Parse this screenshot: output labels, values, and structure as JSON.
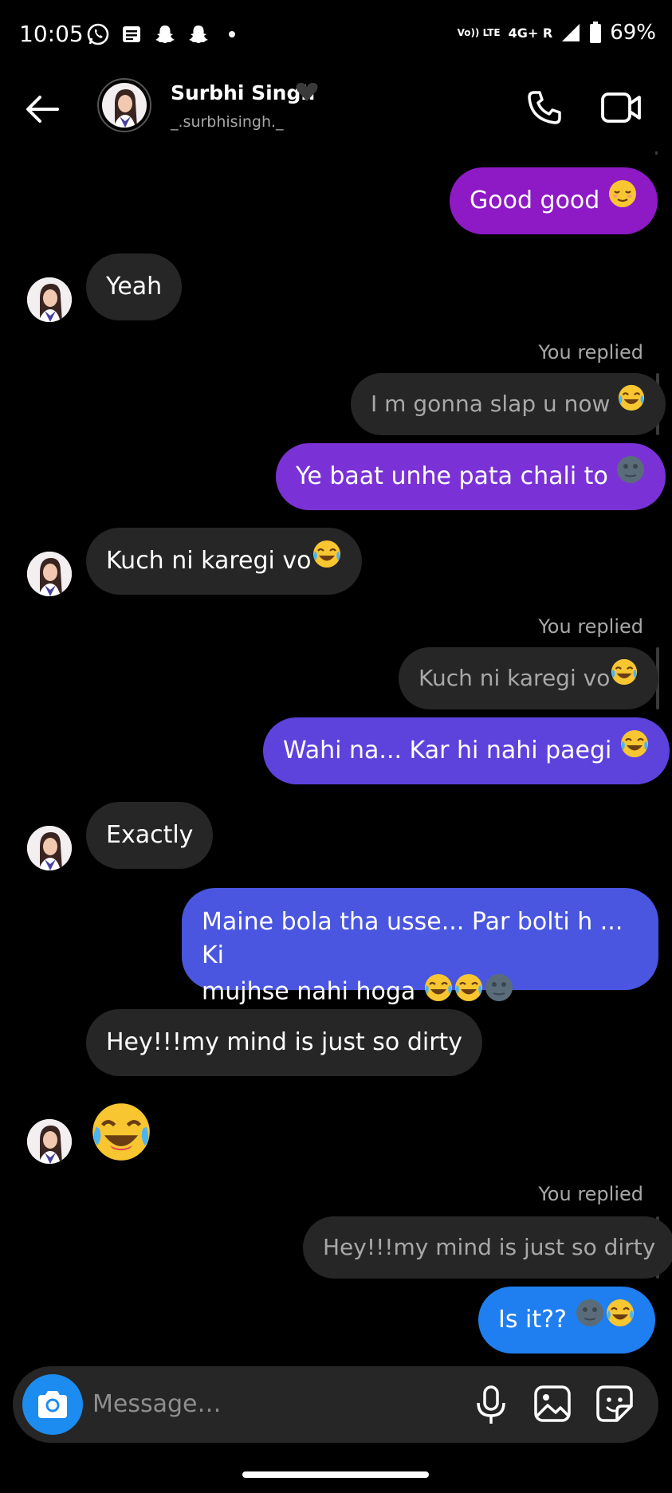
{
  "status_bar": {
    "time": "10:05",
    "notification_icons": [
      "whatsapp-icon",
      "message-icon",
      "snapchat-icon",
      "snapchat-icon",
      "dot-icon"
    ],
    "network_label": "Vo)) LTE",
    "network_type": "4G+ R",
    "battery": "69%"
  },
  "header": {
    "name": "Surbhi Singh",
    "name_emoji": "black-heart-icon",
    "username": "_.surbhisingh._"
  },
  "messages": [
    {
      "side": "out",
      "text": "Good good",
      "emoji": "relieved-face",
      "color": "#8e1ac6"
    },
    {
      "side": "in",
      "text": "Yeah",
      "avatar": true
    },
    {
      "side": "out",
      "replied_label": "You replied",
      "quote": "I m gonna slap u now",
      "quote_emoji": "joy",
      "text": "Ye baat unhe pata chali to",
      "emoji": "new-moon-face",
      "color": "#7a32d6"
    },
    {
      "side": "in",
      "text": "Kuch ni karegi vo",
      "emoji": "joy",
      "avatar": true
    },
    {
      "side": "out",
      "replied_label": "You replied",
      "quote": "Kuch ni karegi vo",
      "quote_emoji": "joy",
      "text": "Wahi na... Kar hi nahi paegi",
      "emoji": "joy",
      "color": "#5d42dc"
    },
    {
      "side": "in",
      "text": "Exactly",
      "avatar": true
    },
    {
      "side": "out",
      "text_line1": "Maine bola tha usse... Par bolti h ... Ki",
      "text_line2": "mujhse nahi hoga",
      "emoji": "joy joy new-moon-face",
      "color": "#4a56e0"
    },
    {
      "side": "in",
      "text": "Hey!!!my mind is just so dirty"
    },
    {
      "side": "in",
      "emoji_only": "joy",
      "avatar": true
    },
    {
      "side": "out",
      "replied_label": "You replied",
      "quote": "Hey!!!my mind is just so dirty",
      "text": "Is it??",
      "emoji": "new-moon-face joy",
      "color": "#1f7ff0"
    }
  ],
  "composer": {
    "placeholder": "Message…"
  }
}
